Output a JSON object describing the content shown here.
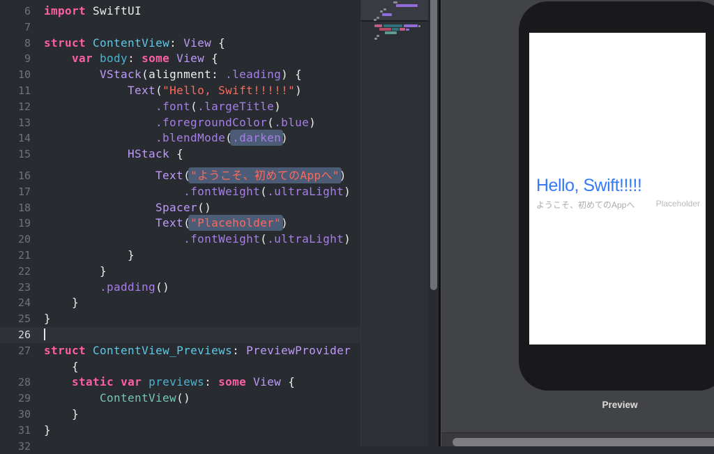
{
  "editor": {
    "current_line": "26",
    "lines": [
      {
        "n": "6",
        "seg": [
          {
            "t": "import",
            "c": "kw"
          },
          {
            "t": " SwiftUI",
            "c": "pl"
          }
        ]
      },
      {
        "n": "7",
        "seg": []
      },
      {
        "n": "8",
        "seg": [
          {
            "t": "struct",
            "c": "kw"
          },
          {
            "t": " ",
            "c": "pl"
          },
          {
            "t": "ContentView",
            "c": "decl"
          },
          {
            "t": ": ",
            "c": "pl"
          },
          {
            "t": "View",
            "c": "type"
          },
          {
            "t": " {",
            "c": "pl"
          }
        ]
      },
      {
        "n": "9",
        "seg": [
          {
            "t": "    ",
            "c": "pl"
          },
          {
            "t": "var",
            "c": "kw"
          },
          {
            "t": " ",
            "c": "pl"
          },
          {
            "t": "body",
            "c": "prop"
          },
          {
            "t": ": ",
            "c": "pl"
          },
          {
            "t": "some",
            "c": "kw"
          },
          {
            "t": " ",
            "c": "pl"
          },
          {
            "t": "View",
            "c": "type"
          },
          {
            "t": " {",
            "c": "pl"
          }
        ]
      },
      {
        "n": "10",
        "seg": [
          {
            "t": "        ",
            "c": "pl"
          },
          {
            "t": "VStack",
            "c": "type"
          },
          {
            "t": "(alignment: ",
            "c": "pl"
          },
          {
            "t": ".leading",
            "c": "meth"
          },
          {
            "t": ") {",
            "c": "pl"
          }
        ]
      },
      {
        "n": "11",
        "seg": [
          {
            "t": "            ",
            "c": "pl"
          },
          {
            "t": "Text",
            "c": "type"
          },
          {
            "t": "(",
            "c": "pl"
          },
          {
            "t": "\"Hello, Swift!!!!!\"",
            "c": "str"
          },
          {
            "t": ")",
            "c": "pl"
          }
        ]
      },
      {
        "n": "12",
        "seg": [
          {
            "t": "                ",
            "c": "pl"
          },
          {
            "t": ".font",
            "c": "meth"
          },
          {
            "t": "(",
            "c": "pl"
          },
          {
            "t": ".largeTitle",
            "c": "meth"
          },
          {
            "t": ")",
            "c": "pl"
          }
        ]
      },
      {
        "n": "13",
        "seg": [
          {
            "t": "                ",
            "c": "pl"
          },
          {
            "t": ".foregroundColor",
            "c": "meth"
          },
          {
            "t": "(",
            "c": "pl"
          },
          {
            "t": ".blue",
            "c": "meth"
          },
          {
            "t": ")",
            "c": "pl"
          }
        ]
      },
      {
        "n": "14",
        "seg": [
          {
            "t": "                ",
            "c": "pl"
          },
          {
            "t": ".blendMode",
            "c": "meth"
          },
          {
            "t": "(",
            "c": "pl"
          },
          {
            "t": ".darken",
            "c": "meth",
            "hl": true
          },
          {
            "t": ")",
            "c": "pl"
          }
        ]
      },
      {
        "n": "15",
        "seg": [
          {
            "t": "            ",
            "c": "pl"
          },
          {
            "t": "HStack",
            "c": "type"
          },
          {
            "t": " {",
            "c": "pl"
          }
        ]
      },
      {
        "n": "16",
        "sp": true,
        "seg": [
          {
            "t": "                ",
            "c": "pl"
          },
          {
            "t": "Text",
            "c": "type"
          },
          {
            "t": "(",
            "c": "pl"
          },
          {
            "t": "\"ようこそ、初めてのAppへ\"",
            "c": "str",
            "hl": true
          },
          {
            "t": ")",
            "c": "pl"
          }
        ]
      },
      {
        "n": "17",
        "seg": [
          {
            "t": "                    ",
            "c": "pl"
          },
          {
            "t": ".fontWeight",
            "c": "meth"
          },
          {
            "t": "(",
            "c": "pl"
          },
          {
            "t": ".ultraLight",
            "c": "meth"
          },
          {
            "t": ")",
            "c": "pl"
          }
        ]
      },
      {
        "n": "18",
        "seg": [
          {
            "t": "                ",
            "c": "pl"
          },
          {
            "t": "Spacer",
            "c": "type"
          },
          {
            "t": "()",
            "c": "pl"
          }
        ]
      },
      {
        "n": "19",
        "seg": [
          {
            "t": "                ",
            "c": "pl"
          },
          {
            "t": "Text",
            "c": "type"
          },
          {
            "t": "(",
            "c": "pl"
          },
          {
            "t": "\"Placeholder\"",
            "c": "str",
            "hl": true
          },
          {
            "t": ")",
            "c": "pl"
          }
        ]
      },
      {
        "n": "20",
        "seg": [
          {
            "t": "                    ",
            "c": "pl"
          },
          {
            "t": ".fontWeight",
            "c": "meth"
          },
          {
            "t": "(",
            "c": "pl"
          },
          {
            "t": ".ultraLight",
            "c": "meth"
          },
          {
            "t": ")",
            "c": "pl"
          }
        ]
      },
      {
        "n": "21",
        "seg": [
          {
            "t": "            }",
            "c": "pl"
          }
        ]
      },
      {
        "n": "22",
        "seg": [
          {
            "t": "        }",
            "c": "pl"
          }
        ]
      },
      {
        "n": "23",
        "seg": [
          {
            "t": "        ",
            "c": "pl"
          },
          {
            "t": ".padding",
            "c": "meth"
          },
          {
            "t": "()",
            "c": "pl"
          }
        ]
      },
      {
        "n": "24",
        "seg": [
          {
            "t": "    }",
            "c": "pl"
          }
        ]
      },
      {
        "n": "25",
        "seg": [
          {
            "t": "}",
            "c": "pl"
          }
        ]
      },
      {
        "n": "26",
        "cur": true,
        "seg": []
      },
      {
        "n": "27",
        "seg": [
          {
            "t": "struct",
            "c": "kw"
          },
          {
            "t": " ",
            "c": "pl"
          },
          {
            "t": "ContentView_Previews",
            "c": "decl"
          },
          {
            "t": ": ",
            "c": "pl"
          },
          {
            "t": "PreviewProvider",
            "c": "type"
          }
        ]
      },
      {
        "n": "",
        "seg": [
          {
            "t": "    {",
            "c": "pl"
          }
        ]
      },
      {
        "n": "28",
        "seg": [
          {
            "t": "    ",
            "c": "pl"
          },
          {
            "t": "static",
            "c": "kw"
          },
          {
            "t": " ",
            "c": "pl"
          },
          {
            "t": "var",
            "c": "kw"
          },
          {
            "t": " ",
            "c": "pl"
          },
          {
            "t": "previews",
            "c": "prop"
          },
          {
            "t": ": ",
            "c": "pl"
          },
          {
            "t": "some",
            "c": "kw"
          },
          {
            "t": " ",
            "c": "pl"
          },
          {
            "t": "View",
            "c": "type"
          },
          {
            "t": " {",
            "c": "pl"
          }
        ]
      },
      {
        "n": "29",
        "seg": [
          {
            "t": "        ",
            "c": "pl"
          },
          {
            "t": "ContentView",
            "c": "proj"
          },
          {
            "t": "()",
            "c": "pl"
          }
        ]
      },
      {
        "n": "30",
        "seg": [
          {
            "t": "    }",
            "c": "pl"
          }
        ]
      },
      {
        "n": "31",
        "seg": [
          {
            "t": "}",
            "c": "pl"
          }
        ]
      },
      {
        "n": "32",
        "seg": []
      }
    ]
  },
  "minimap": {
    "bars": [
      {
        "x": 46,
        "y": 2,
        "w": 6,
        "h": 3,
        "c": "g"
      },
      {
        "x": 50,
        "y": 6,
        "w": 31,
        "h": 4,
        "c": "p"
      },
      {
        "x": 32,
        "y": 12,
        "w": 4,
        "h": 3,
        "c": "g"
      },
      {
        "x": 27,
        "y": 15,
        "w": 4,
        "h": 3,
        "c": "g"
      },
      {
        "x": 30,
        "y": 19,
        "w": 14,
        "h": 4,
        "c": "p"
      },
      {
        "x": 22,
        "y": 24,
        "w": 4,
        "h": 3,
        "c": "g"
      },
      {
        "x": 18,
        "y": 27,
        "w": 4,
        "h": 3,
        "c": "g"
      },
      {
        "x": 19,
        "y": 35,
        "w": 11,
        "h": 4,
        "c": "pk"
      },
      {
        "x": 32,
        "y": 35,
        "w": 27,
        "h": 4,
        "c": "t"
      },
      {
        "x": 61,
        "y": 35,
        "w": 20,
        "h": 4,
        "c": "p"
      },
      {
        "x": 82,
        "y": 36,
        "w": 3,
        "h": 3,
        "c": "g"
      },
      {
        "x": 26,
        "y": 40,
        "w": 17,
        "h": 4,
        "c": "cr"
      },
      {
        "x": 44,
        "y": 40,
        "w": 10,
        "h": 4,
        "c": "t"
      },
      {
        "x": 55,
        "y": 40,
        "w": 8,
        "h": 4,
        "c": "pk"
      },
      {
        "x": 64,
        "y": 41,
        "w": 5,
        "h": 3,
        "c": "p"
      },
      {
        "x": 34,
        "y": 45,
        "w": 17,
        "h": 4,
        "c": "sf"
      },
      {
        "x": 22,
        "y": 50,
        "w": 4,
        "h": 3,
        "c": "g"
      },
      {
        "x": 19,
        "y": 54,
        "w": 4,
        "h": 3,
        "c": "g"
      }
    ]
  },
  "preview": {
    "label": "Preview",
    "screen": {
      "title": "Hello, Swift!!!!!",
      "subtitle": "ようこそ、初めてのAppへ",
      "trailing": "Placeholder"
    }
  },
  "colors": {
    "editor_background": "#282B30",
    "current_line_background": "#2F3339",
    "keyword_pink": "#FC5FA3",
    "type_purple": "#BE9BF8",
    "method_purple": "#A77FE8",
    "declaration_blue": "#5FC9E8",
    "property_teal": "#4FB2CE",
    "project_type_mint": "#78C7B2",
    "string_orange": "#FC6A5D",
    "token_highlight": "#4C5B76",
    "preview_background": "#424345",
    "device_frame": "#19191B",
    "hello_text_blue": "#377AF6"
  }
}
